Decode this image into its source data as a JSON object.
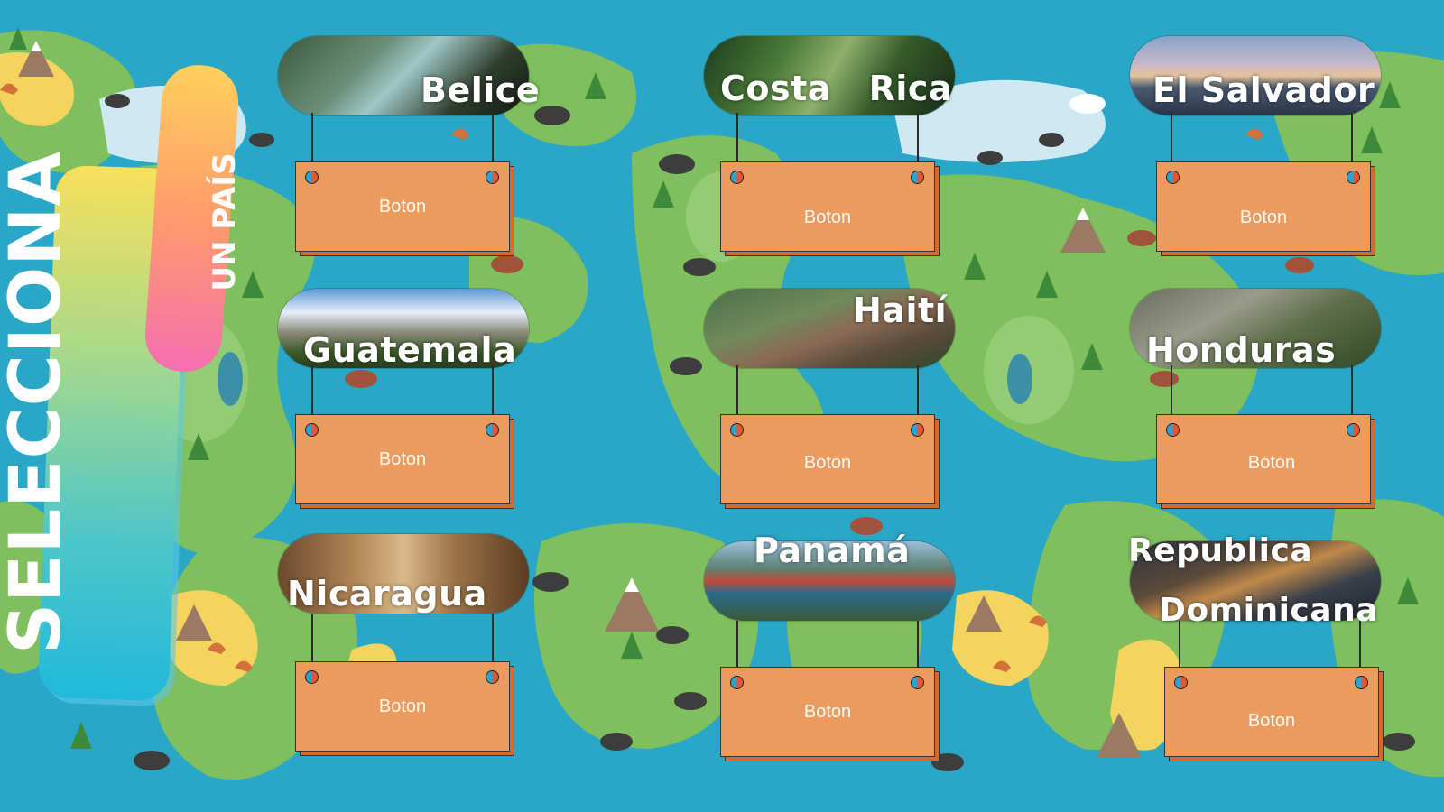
{
  "title": {
    "main": "SELECCIONA",
    "sub": "UN PAÍS"
  },
  "countries": [
    {
      "name": "Belice",
      "button_label": "Boton",
      "photo": "cenote-cave-icon"
    },
    {
      "name": "Costa Rica",
      "button_label": "Boton",
      "photo": "rainforest-bridge-icon"
    },
    {
      "name": "El Salvador",
      "button_label": "Boton",
      "photo": "volcano-icon"
    },
    {
      "name": "Guatemala",
      "button_label": "Boton",
      "photo": "maya-temple-icon"
    },
    {
      "name": "Haití",
      "button_label": "Boton",
      "photo": "citadel-fortress-icon"
    },
    {
      "name": "Honduras",
      "button_label": "Boton",
      "photo": "maya-ruins-icon"
    },
    {
      "name": "Nicaragua",
      "button_label": "Boton",
      "photo": "cathedral-interior-icon"
    },
    {
      "name": "Panamá",
      "button_label": "Boton",
      "photo": "canal-locks-ship-icon"
    },
    {
      "name": "Republica Dominicana",
      "name_line1": "Republica",
      "name_line2": "Dominicana",
      "button_label": "Boton",
      "photo": "city-night-icon"
    }
  ],
  "colors": {
    "ocean": "#2aa7c7",
    "land": "#7fbf5e",
    "land_light": "#9ad07a",
    "ice": "#cfe9f3",
    "desert": "#f4d35e",
    "sign": "#ec9b5f",
    "sign_shadow": "#d66a2c"
  }
}
